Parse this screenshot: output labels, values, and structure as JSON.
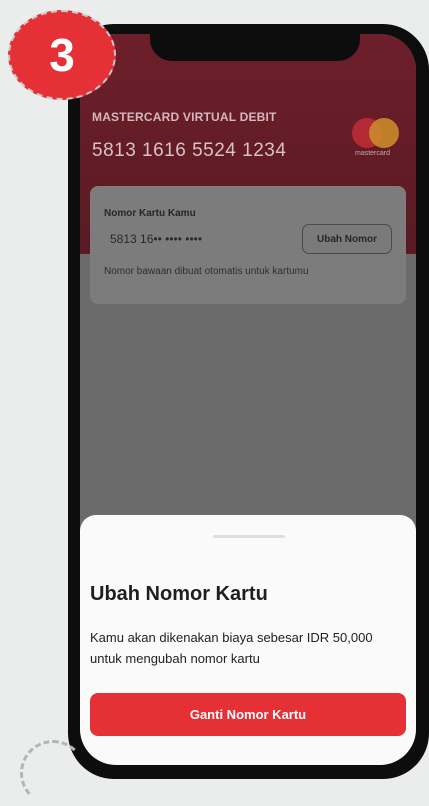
{
  "step_number": "3",
  "card": {
    "title": "MASTERCARD VIRTUAL DEBIT",
    "number": "5813 1616 5524 1234",
    "brand_text": "mastercard"
  },
  "card_info": {
    "label": "Nomor Kartu Kamu",
    "masked_number": "5813 16•• •••• ••••",
    "change_button": "Ubah Nomor",
    "note": "Nomor bawaan dibuat otomatis untuk kartumu"
  },
  "sheet": {
    "title": "Ubah Nomor Kartu",
    "body": "Kamu akan dikenakan biaya sebesar IDR 50,000 untuk mengubah nomor kartu",
    "button": "Ganti Nomor Kartu"
  },
  "colors": {
    "accent": "#e53035",
    "card_bg": "#6d1f2a",
    "overlay": "#6b6b6b"
  }
}
